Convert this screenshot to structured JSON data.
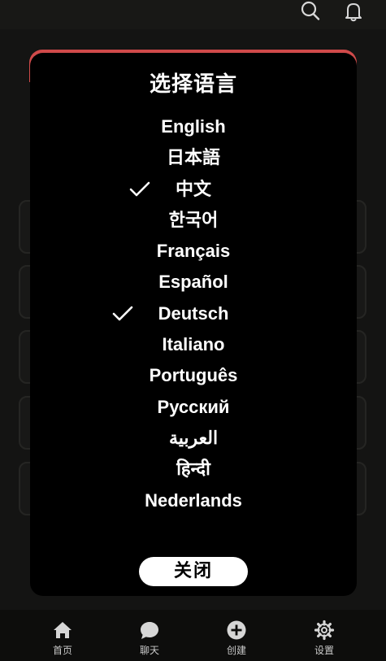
{
  "dialog": {
    "title": "选择语言",
    "close_label": "关闭",
    "languages": [
      {
        "label": "English",
        "checked": false
      },
      {
        "label": "日本語",
        "checked": false
      },
      {
        "label": "中文",
        "checked": true
      },
      {
        "label": "한국어",
        "checked": false
      },
      {
        "label": "Français",
        "checked": false
      },
      {
        "label": "Español",
        "checked": false
      },
      {
        "label": "Deutsch",
        "checked": true
      },
      {
        "label": "Italiano",
        "checked": false
      },
      {
        "label": "Português",
        "checked": false
      },
      {
        "label": "Русский",
        "checked": false
      },
      {
        "label": "العربية",
        "checked": false
      },
      {
        "label": "हिन्दी",
        "checked": false
      },
      {
        "label": "Nederlands",
        "checked": false
      }
    ]
  },
  "topbar": {
    "icons": [
      "search-icon",
      "bell-icon"
    ]
  },
  "tabbar": {
    "tabs": [
      {
        "label": "首页",
        "icon": "home-icon"
      },
      {
        "label": "聊天",
        "icon": "chat-icon"
      },
      {
        "label": "创建",
        "icon": "plus-circle-icon"
      },
      {
        "label": "设置",
        "icon": "gear-icon"
      }
    ]
  },
  "colors": {
    "dialog_bg": "#000000",
    "accent": "#d04a4a",
    "text": "#ffffff",
    "tabbar_bg": "#0d0d0c"
  }
}
